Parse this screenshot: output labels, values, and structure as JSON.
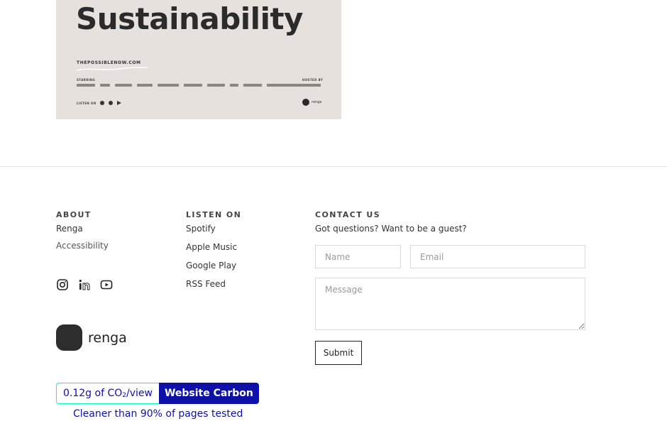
{
  "poster": {
    "title": "Sustainability",
    "url": "THEPOSSIBLENOW.COM",
    "starring_label": "STARRING",
    "hosted_label": "HOSTED BY",
    "listen_label": "LISTEN ON",
    "brand": "renga"
  },
  "footer": {
    "about": {
      "heading": "ABOUT",
      "links": [
        "Renga",
        "Accessibility"
      ]
    },
    "listen": {
      "heading": "LISTEN ON",
      "links": [
        "Spotify",
        "Apple Music",
        "Google Play",
        "RSS Feed"
      ]
    },
    "contact": {
      "heading": "CONTACT US",
      "subtitle": "Got questions? Want to be a guest?",
      "name_placeholder": "Name",
      "email_placeholder": "Email",
      "message_placeholder": "Message",
      "submit_label": "Submit"
    },
    "social_icons": [
      "instagram-icon",
      "linkedin-icon",
      "youtube-icon"
    ],
    "logo_text": "renga"
  },
  "carbon": {
    "value_prefix": "0.12g of CO",
    "value_sub": "2",
    "value_suffix": "/view",
    "brand": "Website Carbon",
    "note": "Cleaner than 90% of pages tested",
    "accent": "#0e11a8",
    "border": "#00ffbc"
  }
}
